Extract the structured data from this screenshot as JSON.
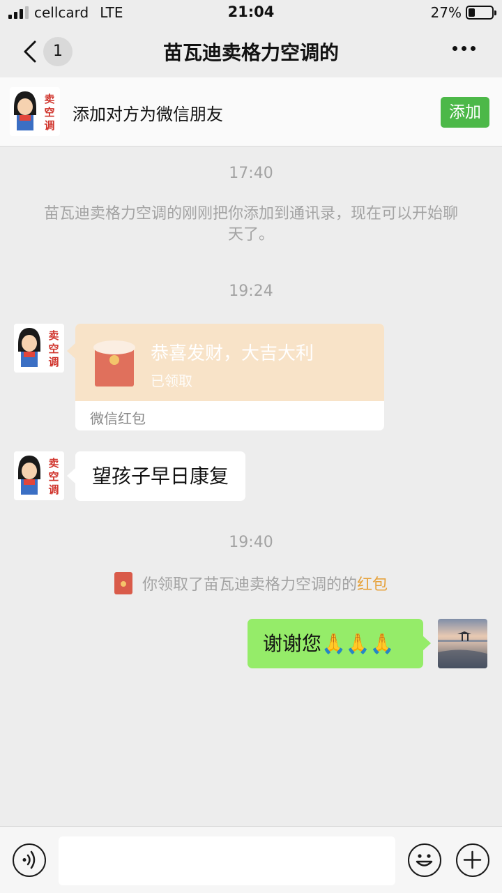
{
  "status_bar": {
    "carrier": "cellcard",
    "network": "LTE",
    "time": "21:04",
    "battery_percent": "27%",
    "battery_level": 0.27,
    "signal_bars": 3
  },
  "nav": {
    "unread_count": "1",
    "title": "苗瓦迪卖格力空调的"
  },
  "banner": {
    "text": "添加对方为微信朋友",
    "add_label": "添加"
  },
  "avatar_label": "卖空调",
  "chat": {
    "time1": "17:40",
    "system_added": "苗瓦迪卖格力空调的刚刚把你添加到通讯录，现在可以开始聊天了。",
    "time2": "19:24",
    "red_packet": {
      "title": "恭喜发财，大吉大利",
      "status": "已领取",
      "footer": "微信红包"
    },
    "msg_text": "望孩子早日康复",
    "time3": "19:40",
    "notice_prefix": "你领取了苗瓦迪卖格力空调的的",
    "notice_link": "红包",
    "reply_text": "谢谢您🙏🙏🙏"
  },
  "input": {
    "placeholder": ""
  },
  "colors": {
    "accent_green": "#4cb848",
    "bubble_green": "#95ec69",
    "red_packet_bg": "#f8e3c8",
    "red_packet_icon": "#e0705c",
    "link_orange": "#e6a23c"
  }
}
